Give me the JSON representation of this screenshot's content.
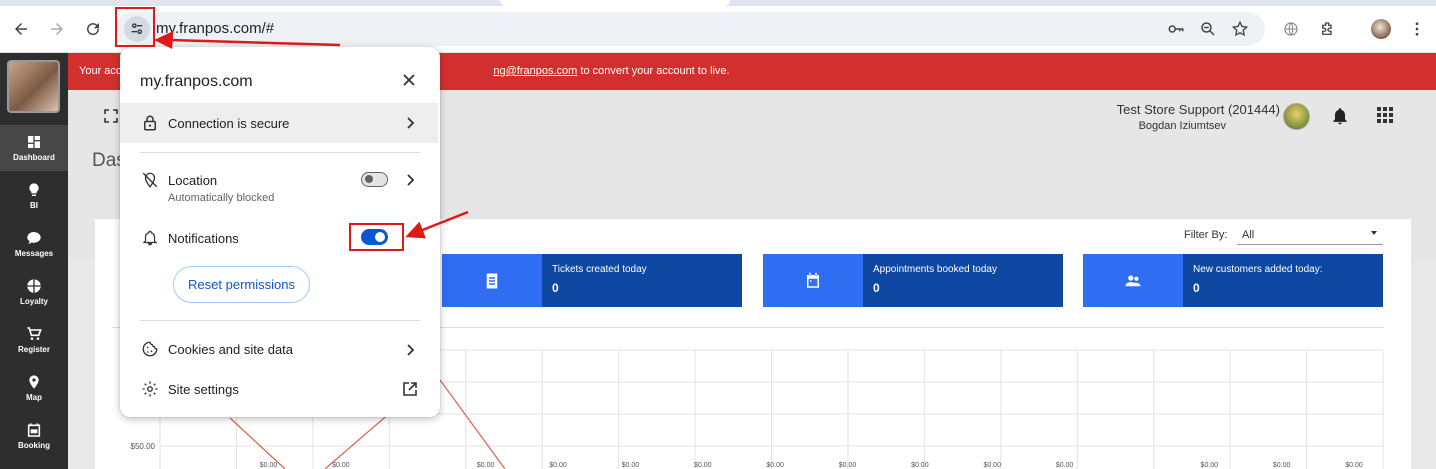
{
  "browser": {
    "url": "my.franpos.com/#"
  },
  "sidebar": {
    "items": [
      {
        "label": "Dashboard",
        "icon": "dashboard-icon",
        "active": true
      },
      {
        "label": "BI",
        "icon": "lightbulb-icon"
      },
      {
        "label": "Messages",
        "icon": "chat-bubble-icon"
      },
      {
        "label": "Loyalty",
        "icon": "loyalty-icon"
      },
      {
        "label": "Register",
        "icon": "cart-icon"
      },
      {
        "label": "Map",
        "icon": "map-pin-icon"
      },
      {
        "label": "Booking",
        "icon": "calendar-icon"
      }
    ]
  },
  "banner": {
    "prefix": "Your acc",
    "email": "ng@franpos.com",
    "suffix": " to convert your account to live.",
    "color": "#d32f2f"
  },
  "header": {
    "page_title": "Das",
    "store_name": "Test Store Support (201444)",
    "user_name": "Bogdan Iziumtsev"
  },
  "filter": {
    "label": "Filter By:",
    "value": "All"
  },
  "stats": [
    {
      "label": "Tickets created today",
      "value": "0",
      "icon": "receipt-icon"
    },
    {
      "label": "Appointments booked today",
      "value": "0",
      "icon": "calendar-icon"
    },
    {
      "label": "New customers added today:",
      "value": "0",
      "icon": "people-icon"
    }
  ],
  "chart_data": {
    "type": "line",
    "y_tick_labels": [
      "$50.00"
    ],
    "point_labels": [
      "$0.00",
      "$0.00",
      "$0.00",
      "$0.00",
      "$0.00",
      "$0.00",
      "$0.00",
      "$0.00",
      "$0.00",
      "$0.00",
      "$0.00",
      "$0.00",
      "$0.00",
      "$0.00"
    ],
    "line_color": "#e06050",
    "grid": true
  },
  "popup": {
    "domain": "my.franpos.com",
    "connection_label": "Connection is secure",
    "location_label": "Location",
    "location_sub": "Automatically blocked",
    "location_enabled": false,
    "notifications_label": "Notifications",
    "notifications_enabled": true,
    "reset_label": "Reset permissions",
    "cookies_label": "Cookies and site data",
    "site_settings_label": "Site settings",
    "accent": "#0b57d0"
  },
  "annotation_color": "#e01818"
}
